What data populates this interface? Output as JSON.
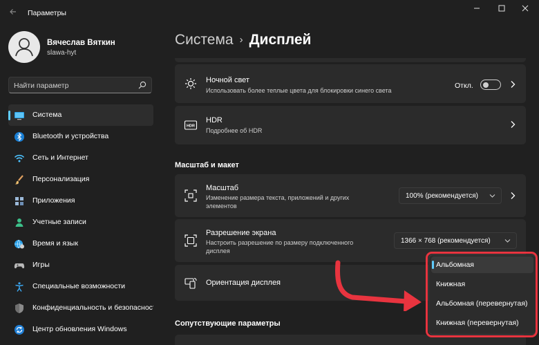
{
  "window": {
    "title": "Параметры",
    "back_icon": "arrow-left-icon",
    "minimize_icon": "minimize-icon",
    "maximize_icon": "maximize-icon",
    "close_icon": "close-icon"
  },
  "profile": {
    "name": "Вячеслав Вяткин",
    "login": "slawa-hyt",
    "avatar_icon": "person-icon"
  },
  "search": {
    "placeholder": "Найти параметр",
    "icon": "search-icon"
  },
  "nav": {
    "items": [
      {
        "label": "Система",
        "icon": "monitor-icon",
        "selected": true
      },
      {
        "label": "Bluetooth и устройства",
        "icon": "bluetooth-icon"
      },
      {
        "label": "Сеть и Интернет",
        "icon": "wifi-icon"
      },
      {
        "label": "Персонализация",
        "icon": "brush-icon"
      },
      {
        "label": "Приложения",
        "icon": "apps-icon"
      },
      {
        "label": "Учетные записи",
        "icon": "accounts-icon"
      },
      {
        "label": "Время и язык",
        "icon": "globe-clock-icon"
      },
      {
        "label": "Игры",
        "icon": "gamepad-icon"
      },
      {
        "label": "Специальные возможности",
        "icon": "accessibility-icon"
      },
      {
        "label": "Конфиденциальность и безопасность",
        "icon": "shield-icon"
      },
      {
        "label": "Центр обновления Windows",
        "icon": "update-icon"
      }
    ]
  },
  "breadcrumb": {
    "parent": "Система",
    "separator": "›",
    "current": "Дисплей"
  },
  "night_light": {
    "title": "Ночной свет",
    "subtitle": "Использовать более теплые цвета для блокировки синего света",
    "toggle_text": "Откл.",
    "toggle_on": false,
    "icon": "brightness-icon"
  },
  "hdr": {
    "title": "HDR",
    "subtitle": "Подробнее об HDR",
    "icon": "hdr-icon"
  },
  "scale_section": {
    "label": "Масштаб и макет"
  },
  "scale": {
    "title": "Масштаб",
    "subtitle_line1": "Изменение размера текста, приложений и других",
    "subtitle_line2": "элементов",
    "value": "100% (рекомендуется)",
    "icon": "resize-icon"
  },
  "resolution": {
    "title": "Разрешение экрана",
    "subtitle_line1": "Настроить разрешение по размеру подключенного",
    "subtitle_line2": "дисплея",
    "value": "1366 × 768 (рекомендуется)",
    "icon": "resolution-icon"
  },
  "orientation": {
    "title": "Ориентация дисплея",
    "icon": "orientation-icon",
    "options": [
      {
        "label": "Альбомная",
        "selected": true
      },
      {
        "label": "Книжная"
      },
      {
        "label": "Альбомная (перевернутая)"
      },
      {
        "label": "Книжная (перевернутая)"
      }
    ]
  },
  "related_section": {
    "label": "Сопутствующие параметры"
  },
  "colors": {
    "accent": "#60cdff",
    "annotation": "#e8343f",
    "background": "#202020",
    "card": "#2b2b2b"
  }
}
